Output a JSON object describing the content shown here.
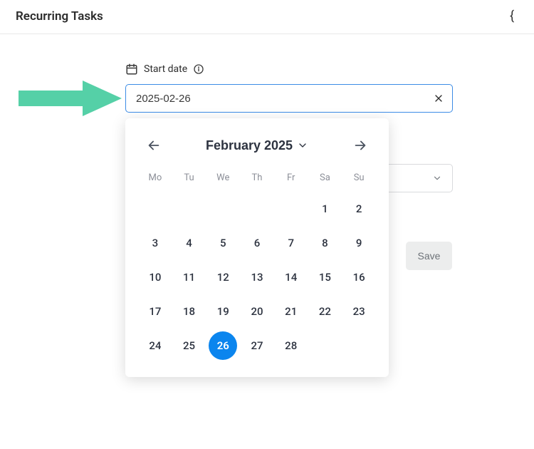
{
  "header": {
    "title": "Recurring Tasks"
  },
  "field": {
    "label": "Start date",
    "value": "2025-02-26"
  },
  "calendar": {
    "monthLabel": "February 2025",
    "weekdays": [
      "Mo",
      "Tu",
      "We",
      "Th",
      "Fr",
      "Sa",
      "Su"
    ],
    "leadingBlanks": 5,
    "days": [
      1,
      2,
      3,
      4,
      5,
      6,
      7,
      8,
      9,
      10,
      11,
      12,
      13,
      14,
      15,
      16,
      17,
      18,
      19,
      20,
      21,
      22,
      23,
      24,
      25,
      26,
      27,
      28
    ],
    "selectedDay": 26
  },
  "buttons": {
    "save": "Save"
  }
}
